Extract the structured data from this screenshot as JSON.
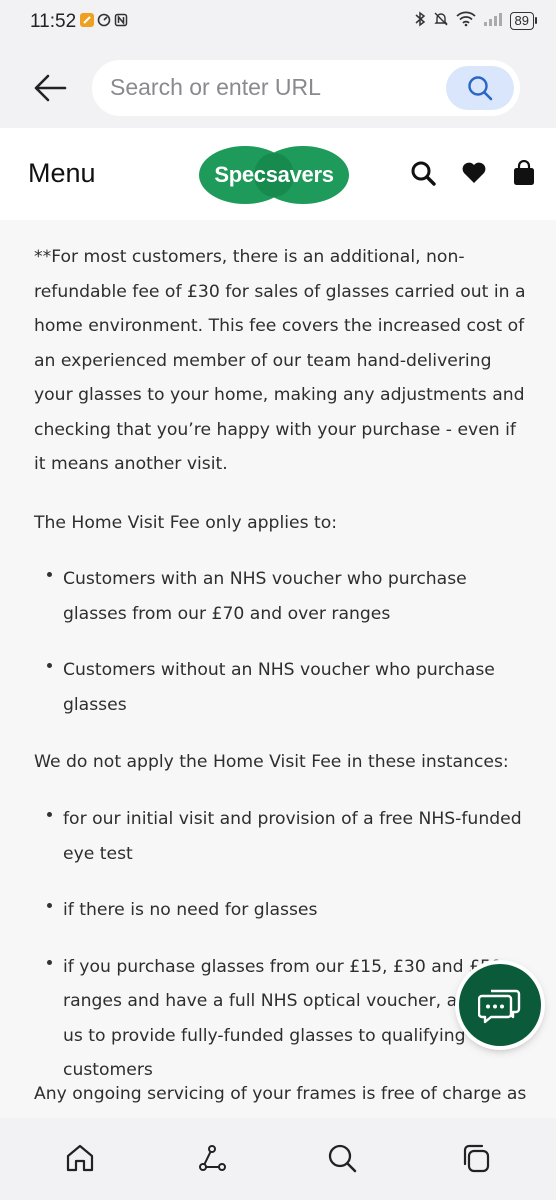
{
  "status_bar": {
    "time": "11:52",
    "battery": "89"
  },
  "browser": {
    "search_placeholder": "Search or enter URL"
  },
  "site_header": {
    "menu_label": "Menu",
    "logo_text": "Specsavers",
    "brand_color": "#1e9a5a"
  },
  "content": {
    "paragraph_fee": "**For most customers, there is an additional, non-refundable fee of £30 for sales of glasses carried out in a home environment. This fee covers the increased cost of an experienced member of our team hand-delivering your glasses to your home, making any adjustments and checking that you’re happy with your purchase - even if it means another visit.",
    "applies_heading": "The Home Visit Fee only applies to:",
    "applies_items": [
      "Customers with an NHS voucher who purchase glasses from our £70 and over ranges",
      "Customers without an NHS voucher who purchase glasses"
    ],
    "not_apply_heading": "We do not apply the Home Visit Fee in these instances:",
    "not_apply_items": [
      "for our initial visit and provision of a free NHS-funded eye test",
      "if there is no need for glasses",
      "if you purchase glasses from our £15, £30 and £50 ranges and have a full NHS optical voucher, allowing us to provide fully-funded glasses to qualifying customers"
    ],
    "servicing_text": "Any ongoing servicing of your frames is free of charge as"
  },
  "icons": {
    "back": "arrow-left-icon",
    "search": "search-icon",
    "wishlist": "heart-icon",
    "basket": "bag-icon",
    "chat": "chat-icon",
    "nav_home": "home-icon",
    "nav_share": "share-icon",
    "nav_search": "search-icon",
    "nav_tabs": "tabs-icon"
  }
}
